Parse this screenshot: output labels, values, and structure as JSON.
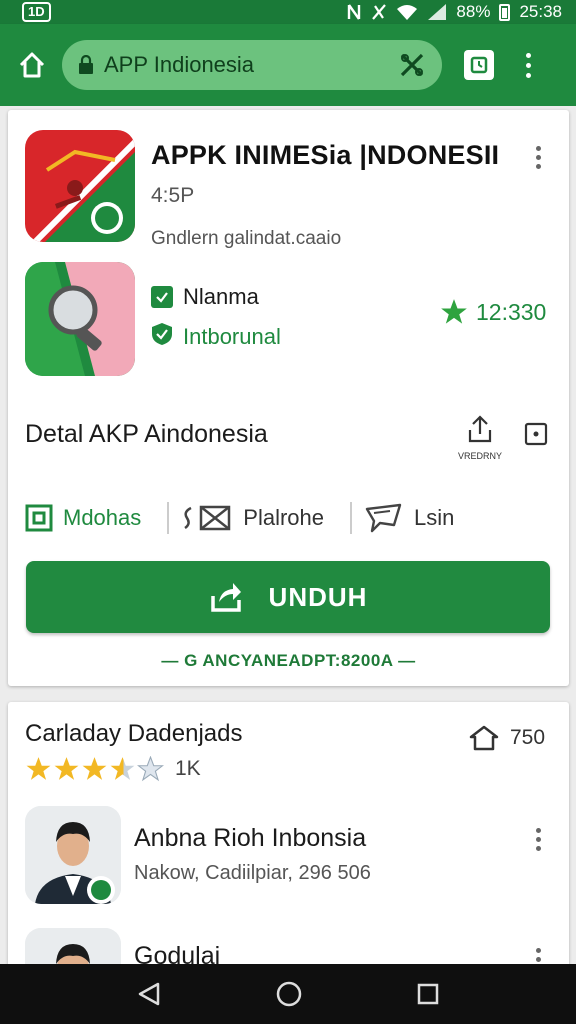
{
  "status_bar": {
    "left_badge": "1D",
    "battery": "88%",
    "time": "25:38",
    "icons": [
      "nfc-icon",
      "wifi-icon",
      "signal-icon",
      "battery-icon"
    ]
  },
  "toolbar": {
    "url": "APP Indionesia",
    "icons": [
      "home-icon",
      "lock-icon",
      "tools-icon",
      "tabs-icon",
      "more-vert-icon"
    ]
  },
  "app": {
    "title": "APPK INIMESia |NDONESII",
    "rating": "4:5P",
    "subtitle": "Gndlern galindat.caaio",
    "features": [
      {
        "label": "Nlanma",
        "icon": "check-square-icon"
      },
      {
        "label": "Intborunal",
        "icon": "shield-check-icon"
      }
    ],
    "score": "12:330",
    "detail_title": "Detal AKP Aindonesia",
    "share_label": "VREDRNY",
    "tabs": [
      {
        "label": "Mdohas",
        "icon": "square-icon",
        "active": true
      },
      {
        "label": "Plalrohe",
        "icon": "pay-icon",
        "active": false
      },
      {
        "label": "Lsin",
        "icon": "chat-icon",
        "active": false
      }
    ],
    "download_label": "UNDUH",
    "download_note": "— G ANCYANEADPT:8200A —"
  },
  "section2": {
    "title": "Carladay Dadenjads",
    "stars_value": 3.5,
    "stars_count": "1K",
    "right_value": "750",
    "people": [
      {
        "name": "Anbna Rioh Inbonsia",
        "sub": "Nakow, Cadiilpiar, 296 506"
      },
      {
        "name": "Godulai",
        "sub": ""
      }
    ]
  },
  "colors": {
    "brand_green": "#1f8a3f",
    "url_bar": "#6cc27e",
    "star": "#f2b824",
    "score_star": "#2fa33f"
  }
}
